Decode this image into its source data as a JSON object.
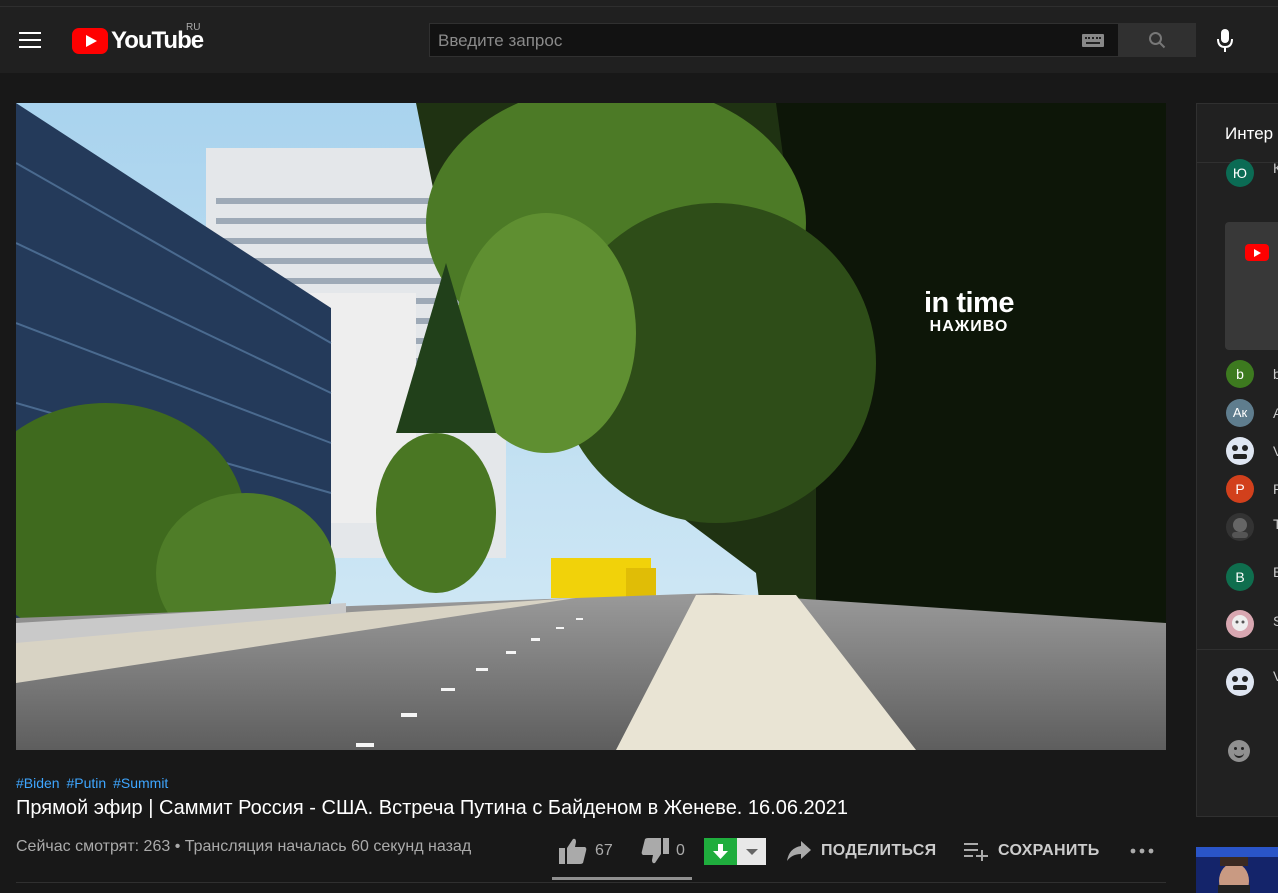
{
  "masthead": {
    "logo_text": "YouTube",
    "region": "RU",
    "search_placeholder": "Введите запрос"
  },
  "video": {
    "watermark_brand": "in time",
    "watermark_live": "НАЖИВО",
    "hashtags": [
      "#Biden",
      "#Putin",
      "#Summit"
    ],
    "title": "Прямой эфир | Саммит Россия - США. Встреча Путина с Байденом в Женеве. 16.06.2021",
    "viewers": "Сейчас смотрят: 263 • Трансляция началась 60 секунд назад",
    "likes": "67",
    "dislikes": "0",
    "like_ratio": 1.0,
    "share_label": "ПОДЕЛИТЬСЯ",
    "save_label": "СОХРАНИТЬ"
  },
  "chat": {
    "header_partial": "Интер",
    "messages": [
      {
        "avatar": "Ю",
        "color": "#0b6b54",
        "name": "К"
      },
      {
        "avatar": "b",
        "color": "#3d7a1f",
        "name": "b"
      },
      {
        "avatar": "Ак",
        "color": "#5f7d8e",
        "name": "А"
      },
      {
        "avatar": "",
        "color": "#2f4fb0",
        "name": "V"
      },
      {
        "avatar": "P",
        "color": "#d2401c",
        "name": "P"
      },
      {
        "avatar": "",
        "color": "#444444",
        "name": "T"
      },
      {
        "avatar": "B",
        "color": "#0f6e4e",
        "name": "B"
      },
      {
        "avatar": "",
        "color": "#c48a96",
        "name": "S"
      }
    ],
    "input_author_partial": "V"
  },
  "colors": {
    "background": "#181818",
    "masthead": "#202020",
    "link": "#3ea6ff",
    "download": "#1fad3d",
    "brand_red": "#ff0000"
  }
}
